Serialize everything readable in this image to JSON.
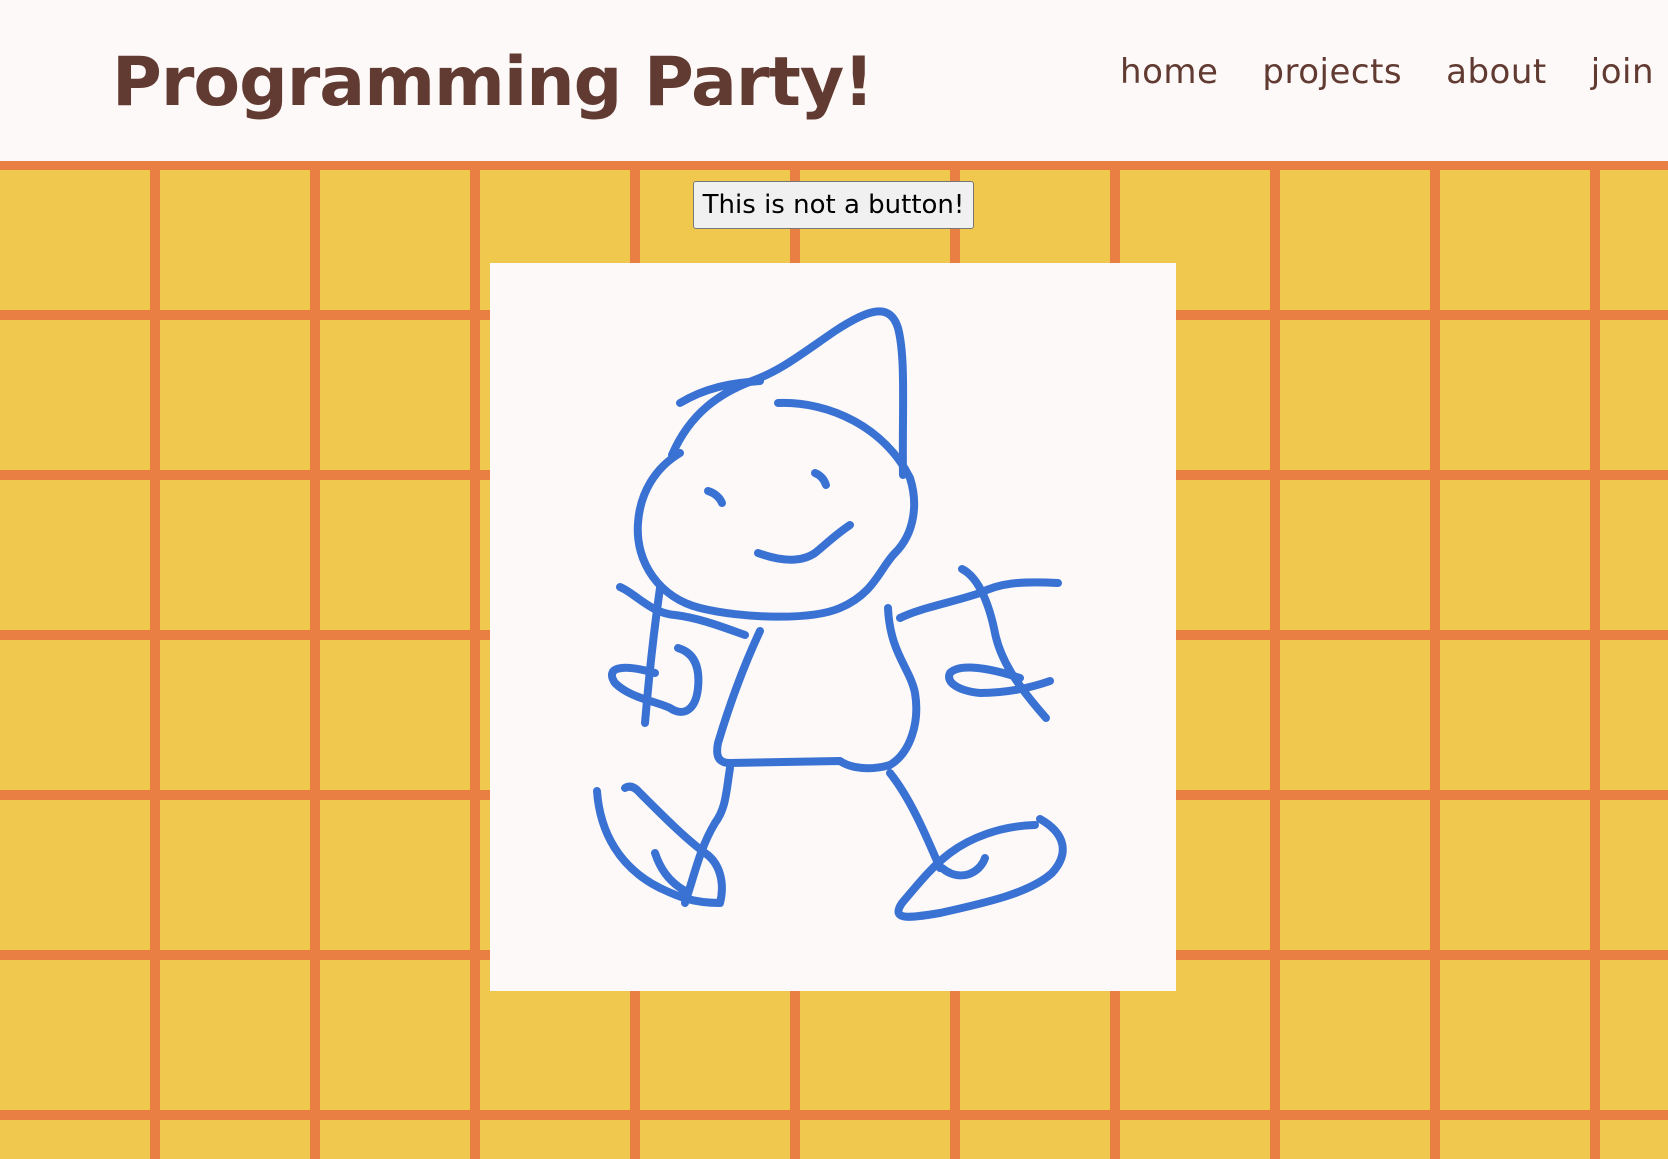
{
  "site": {
    "title": "Programming Party!"
  },
  "nav": {
    "items": [
      {
        "label": "home"
      },
      {
        "label": "projects"
      },
      {
        "label": "about"
      },
      {
        "label": "join"
      }
    ]
  },
  "main": {
    "fake_button_label": "This is not a button!",
    "drawing": {
      "icon": "hand-drawn-stick-figure",
      "stroke_color": "#3a72d4"
    }
  },
  "colors": {
    "background": "#f0c84e",
    "grid_lines": "#e97f42",
    "header_bg": "#fdf9f8",
    "text": "#613a31"
  }
}
